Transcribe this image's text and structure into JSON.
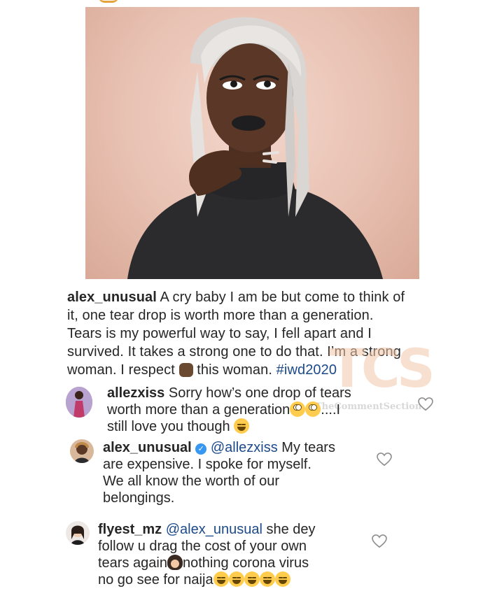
{
  "post": {
    "caption_username": "alex_unusual",
    "caption_line1": " A cry baby I am be but come to think of",
    "caption_line2": "it, one tear drop is worth more than a generation.",
    "caption_line3": "Tears is my powerful way to say, I fell apart and I",
    "caption_line4": "survived. It takes a strong one to do that. I’m a strong",
    "caption_line5a": "woman. I respect ",
    "caption_line5b": " this woman. ",
    "hashtag": "#iwd2020"
  },
  "comments": [
    {
      "username": "allezxiss",
      "line1": " Sorry how’s one drop of tears",
      "line2": "worth more than a generation",
      "line2b": "....I",
      "line3": "still love you though "
    },
    {
      "username": "alex_unusual",
      "mention": "@allezxiss",
      "line1": " My tears",
      "line2": "are expensive. I spoke for myself.",
      "line3": "We all know the worth of our",
      "line4": "belongings."
    },
    {
      "username": "flyest_mz",
      "mention": "@alex_unusual",
      "line1": " she dey",
      "line2": "follow u drag the cost of your own",
      "line3a": "tears again",
      "line3b": "nothing corona virus",
      "line4": "no go see for naija"
    }
  ],
  "watermark": {
    "letters": "TCS",
    "subtitle": "TheCommentSection"
  },
  "colors": {
    "text": "#262626",
    "hashtag": "#1c4a8a",
    "verified": "#3897f0",
    "heart_outline": "#8e8e8e"
  }
}
